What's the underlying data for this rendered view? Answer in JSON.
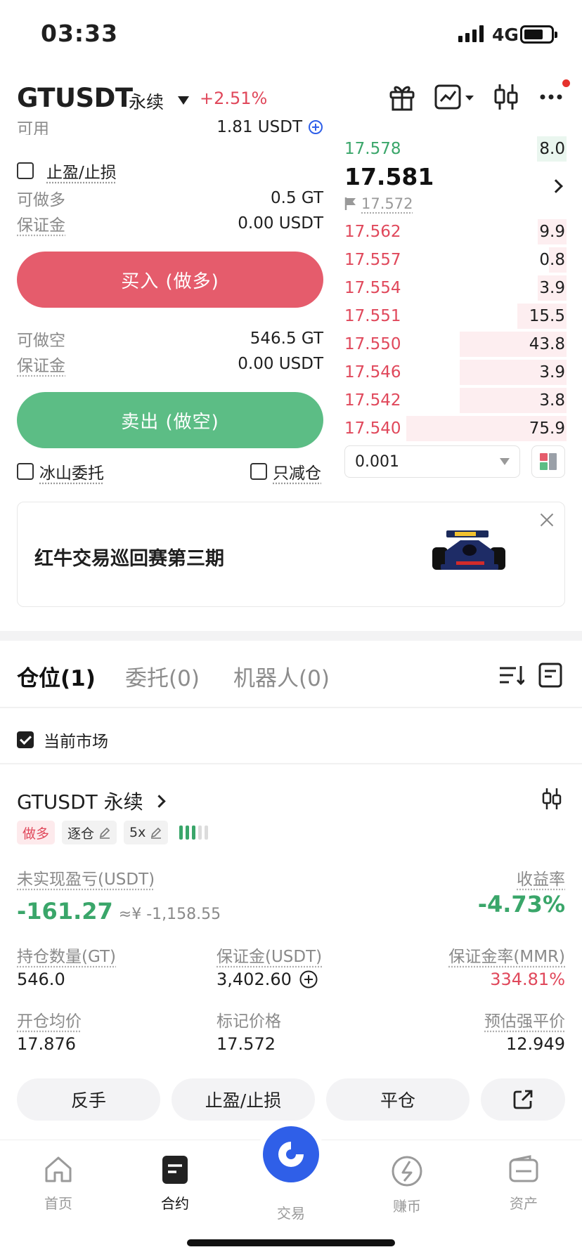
{
  "status_bar": {
    "time": "03:33",
    "network": "4G"
  },
  "header": {
    "pair": "GTUSDT",
    "contract_type": "永续",
    "change": "+2.51%"
  },
  "trade": {
    "available_label": "可用",
    "available_value": "1.81 USDT",
    "tpsl_label": "止盈/止损",
    "long_max_label": "可做多",
    "long_max_value": "0.5 GT",
    "long_margin_label": "保证金",
    "long_margin_value": "0.00 USDT",
    "buy_button": "买入 (做多)",
    "short_max_label": "可做空",
    "short_max_value": "546.5 GT",
    "short_margin_label": "保证金",
    "short_margin_value": "0.00 USDT",
    "sell_button": "卖出 (做空)",
    "iceberg_label": "冰山委托",
    "reduce_only_label": "只减仓"
  },
  "orderbook": {
    "top_buy": {
      "price": "17.578",
      "size": "8.0"
    },
    "last_price": "17.581",
    "mark_price": "17.572",
    "rows": [
      {
        "price": "17.562",
        "size": "9.9",
        "depth": 0.13
      },
      {
        "price": "17.557",
        "size": "0.8",
        "depth": 0.08
      },
      {
        "price": "17.554",
        "size": "3.9",
        "depth": 0.13
      },
      {
        "price": "17.551",
        "size": "15.5",
        "depth": 0.22
      },
      {
        "price": "17.550",
        "size": "43.8",
        "depth": 0.48
      },
      {
        "price": "17.546",
        "size": "3.9",
        "depth": 0.48
      },
      {
        "price": "17.542",
        "size": "3.8",
        "depth": 0.48
      },
      {
        "price": "17.540",
        "size": "75.9",
        "depth": 0.72
      }
    ],
    "precision": "0.001"
  },
  "banner": {
    "text": "红牛交易巡回赛第三期"
  },
  "positions_tabs": {
    "positions": "仓位(1)",
    "orders": "委托(0)",
    "bots": "机器人(0)"
  },
  "filter": {
    "current_market": "当前市场"
  },
  "position": {
    "title": "GTUSDT 永续",
    "side_tag": "做多",
    "margin_mode_tag": "逐仓",
    "leverage_tag": "5x",
    "pnl_label": "未实现盈亏(USDT)",
    "pnl_value": "-161.27",
    "pnl_cny": "≈¥ -1,158.55",
    "roe_label": "收益率",
    "roe_value": "-4.73%",
    "size_label": "持仓数量(GT)",
    "size_value": "546.0",
    "margin_label": "保证金(USDT)",
    "margin_value": "3,402.60",
    "mmr_label": "保证金率(MMR)",
    "mmr_value": "334.81%",
    "entry_label": "开仓均价",
    "entry_value": "17.876",
    "mark_label": "标记价格",
    "mark_value": "17.572",
    "liq_label": "预估强平价",
    "liq_value": "12.949"
  },
  "actions": {
    "reverse": "反手",
    "tpsl": "止盈/止损",
    "close": "平仓"
  },
  "bottom_nav": {
    "home": "首页",
    "contract": "合约",
    "trade": "交易",
    "earn": "赚币",
    "assets": "资产"
  },
  "colors": {
    "buy_red": "#e55c6c",
    "sell_green": "#5cbd85",
    "accent_blue": "#2f5fe8"
  }
}
